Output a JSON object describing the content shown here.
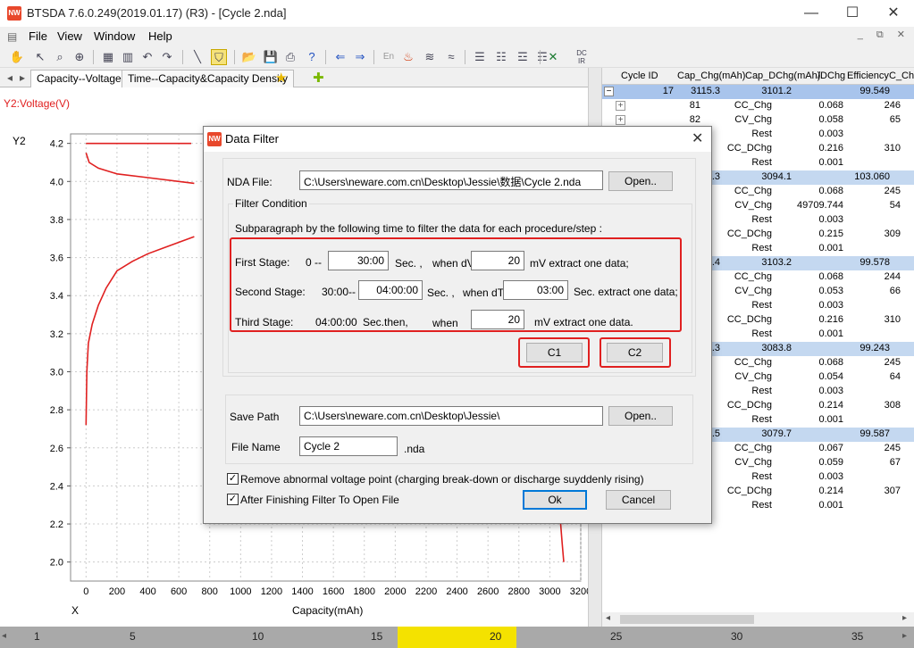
{
  "window": {
    "title": "BTSDA 7.6.0.249(2019.01.17) (R3) - [Cycle 2.nda]",
    "logo_text": "NW"
  },
  "menu": [
    "File",
    "View",
    "Window",
    "Help"
  ],
  "tabs": [
    "Capacity--Voltage",
    "Time--Capacity&Capacity Density"
  ],
  "chart": {
    "y_title": "Y2:Voltage(V)",
    "y_label": "Y2",
    "x_label": "X",
    "x_title": "Capacity(mAh)",
    "line_color": "#e02020"
  },
  "chart_data": {
    "type": "line",
    "xlabel": "Capacity(mAh)",
    "ylabel": "Y2:Voltage(V)",
    "xlim": [
      -100,
      3200
    ],
    "ylim": [
      1.9,
      4.25
    ],
    "x_ticks": [
      "0",
      "200",
      "400",
      "600",
      "800",
      "1000",
      "1200",
      "1400",
      "1600",
      "1800",
      "2000",
      "2200",
      "2400",
      "2600",
      "2800",
      "3000",
      "3200"
    ],
    "y_ticks": [
      "2.0",
      "2.2",
      "2.4",
      "2.6",
      "2.8",
      "3.0",
      "3.2",
      "3.4",
      "3.6",
      "3.8",
      "4.0",
      "4.2"
    ],
    "series": [
      {
        "values_x": [
          0,
          200,
          400,
          600,
          680
        ],
        "values_y": [
          4.2,
          4.2,
          4.2,
          4.2,
          4.2
        ]
      },
      {
        "values_x": [
          0,
          20,
          80,
          200,
          400,
          600,
          700
        ],
        "values_y": [
          4.15,
          4.1,
          4.07,
          4.04,
          4.02,
          4.0,
          3.99
        ]
      },
      {
        "values_x": [
          0,
          5,
          15,
          40,
          80,
          130,
          200,
          300,
          400,
          500,
          600,
          700
        ],
        "values_y": [
          2.72,
          3.0,
          3.15,
          3.25,
          3.35,
          3.44,
          3.53,
          3.58,
          3.62,
          3.65,
          3.68,
          3.71
        ]
      },
      {
        "values_x": [
          3060,
          3070,
          3080,
          3090
        ],
        "values_y": [
          2.45,
          2.2,
          2.1,
          2.0
        ]
      }
    ]
  },
  "grid": {
    "headers": [
      "Cycle ID",
      "Cap_Chg(mAh)",
      "Cap_DChg(mAh)",
      "/DChg",
      "Efficiency",
      "C_Ch"
    ],
    "cycles": [
      {
        "id": "17",
        "chg": "3115.3",
        "dchg": "3101.2",
        "eff": "99.549",
        "steps": [
          {
            "id": "81",
            "name": "CC_Chg",
            "val": "0.068",
            "last": "246"
          },
          {
            "id": "82",
            "name": "CV_Chg",
            "val": "0.058",
            "last": "65"
          },
          {
            "id": "",
            "name": "Rest",
            "val": "0.003",
            "last": ""
          },
          {
            "id": "",
            "name": "CC_DChg",
            "val": "0.216",
            "last": "310"
          },
          {
            "id": "",
            "name": "Rest",
            "val": "0.001",
            "last": ""
          }
        ]
      },
      {
        "id": "",
        "chg": "3002.3",
        "dchg": "3094.1",
        "eff": "103.060",
        "steps": [
          {
            "id": "",
            "name": "CC_Chg",
            "val": "0.068",
            "last": "245"
          },
          {
            "id": "",
            "name": "CV_Chg",
            "val": "49709.744",
            "last": "54"
          },
          {
            "id": "",
            "name": "Rest",
            "val": "0.003",
            "last": ""
          },
          {
            "id": "",
            "name": "CC_DChg",
            "val": "0.215",
            "last": "309"
          },
          {
            "id": "",
            "name": "Rest",
            "val": "0.001",
            "last": ""
          }
        ]
      },
      {
        "id": "",
        "chg": "3116.4",
        "dchg": "3103.2",
        "eff": "99.578",
        "steps": [
          {
            "id": "",
            "name": "CC_Chg",
            "val": "0.068",
            "last": "244"
          },
          {
            "id": "",
            "name": "CV_Chg",
            "val": "0.053",
            "last": "66"
          },
          {
            "id": "",
            "name": "Rest",
            "val": "0.003",
            "last": ""
          },
          {
            "id": "",
            "name": "CC_DChg",
            "val": "0.216",
            "last": "310"
          },
          {
            "id": "",
            "name": "Rest",
            "val": "0.001",
            "last": ""
          }
        ]
      },
      {
        "id": "",
        "chg": "3107.3",
        "dchg": "3083.8",
        "eff": "99.243",
        "steps": [
          {
            "id": "",
            "name": "CC_Chg",
            "val": "0.068",
            "last": "245"
          },
          {
            "id": "",
            "name": "CV_Chg",
            "val": "0.054",
            "last": "64"
          },
          {
            "id": "",
            "name": "Rest",
            "val": "0.003",
            "last": ""
          },
          {
            "id": "",
            "name": "CC_DChg",
            "val": "0.214",
            "last": "308"
          },
          {
            "id": "",
            "name": "Rest",
            "val": "0.001",
            "last": ""
          }
        ]
      },
      {
        "id": "",
        "chg": "3092.5",
        "dchg": "3079.7",
        "eff": "99.587",
        "steps": [
          {
            "id": "",
            "name": "CC_Chg",
            "val": "0.067",
            "last": "245"
          },
          {
            "id": "",
            "name": "CV_Chg",
            "val": "0.059",
            "last": "67"
          },
          {
            "id": "",
            "name": "Rest",
            "val": "0.003",
            "last": ""
          },
          {
            "id": "",
            "name": "CC_DChg",
            "val": "0.214",
            "last": "307"
          },
          {
            "id": "",
            "name": "Rest",
            "val": "0.001",
            "last": ""
          }
        ]
      }
    ]
  },
  "bottom_scale": [
    "1",
    "5",
    "10",
    "15",
    "20",
    "25",
    "30",
    "35"
  ],
  "dialog": {
    "title": "Data Filter",
    "nda_label": "NDA File:",
    "nda_value": "C:\\Users\\neware.com.cn\\Desktop\\Jessie\\数据\\Cycle 2.nda",
    "open_label": "Open..",
    "filter_group": "Filter Condition",
    "subparagraph": "Subparagraph by the following time to filter the data for each procedure/step :",
    "first_stage": "First Stage:",
    "first_from": "0 --",
    "first_time": "30:00",
    "sec1": "Sec. ,",
    "when_dv": "when dV",
    "first_mv": "20",
    "mv_extract": "mV extract one data;",
    "second_stage": "Second Stage:",
    "second_from": "30:00--",
    "second_time": "04:00:00",
    "sec2": "Sec. ,",
    "when_dt": "when dT",
    "second_dt": "03:00",
    "sec_extract": "Sec. extract one data;",
    "third_stage": "Third Stage:",
    "third_from": "04:00:00",
    "sec_then": "Sec.then,",
    "when": "when",
    "third_mv": "20",
    "mv_extract_end": "mV extract one data.",
    "c1": "C1",
    "c2": "C2",
    "save_path_label": "Save Path",
    "save_path_value": "C:\\Users\\neware.com.cn\\Desktop\\Jessie\\",
    "file_name_label": "File Name",
    "file_name_value": "Cycle 2",
    "nda_ext": ".nda",
    "chk1": "Remove abnormal voltage point (charging break-down or discharge suyddenly rising)",
    "chk2": "After Finishing Filter To Open File",
    "ok": "Ok",
    "cancel": "Cancel"
  }
}
